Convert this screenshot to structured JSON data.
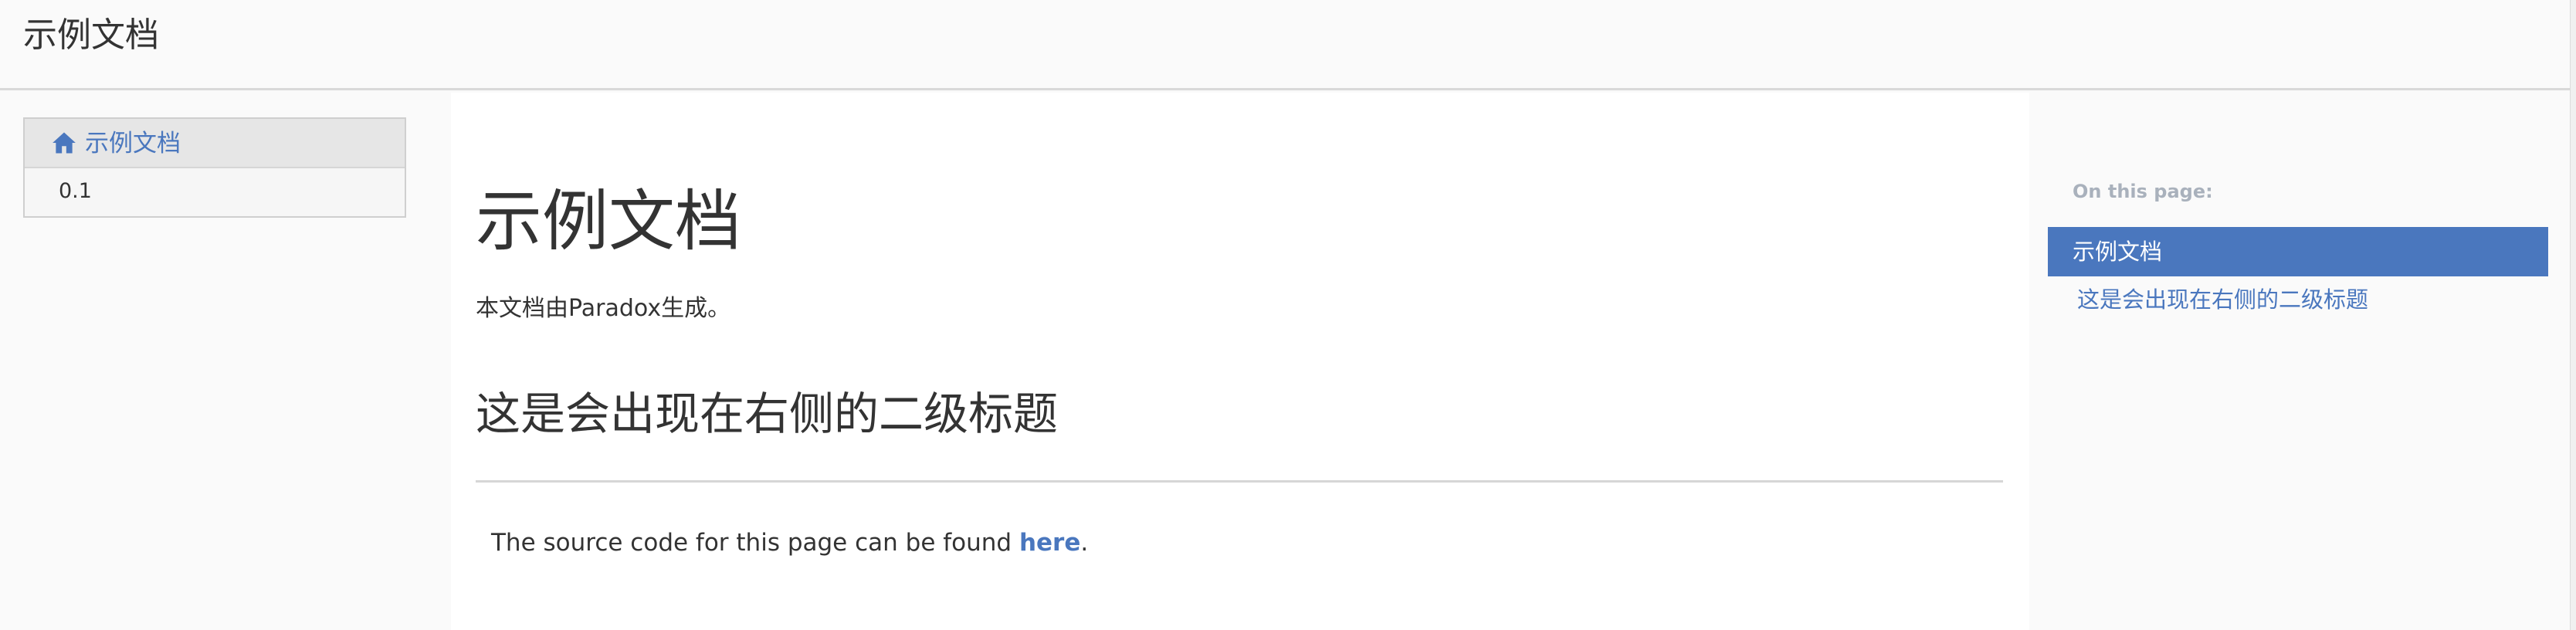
{
  "header": {
    "site_title": "示例文档"
  },
  "sidebar": {
    "items": [
      {
        "label": "示例文档",
        "icon": "home-icon"
      },
      {
        "label": "0.1"
      }
    ]
  },
  "main": {
    "title": "示例文档",
    "intro": "本文档由Paradox生成。",
    "subheading": "这是会出现在右侧的二级标题",
    "source_prefix": "The source code for this page can be found ",
    "source_link": "here",
    "source_suffix": "."
  },
  "toc": {
    "title": "On this page:",
    "items": [
      {
        "label": "示例文档"
      },
      {
        "label": "这是会出现在右侧的二级标题"
      }
    ]
  },
  "colors": {
    "accent": "#4a77be",
    "text": "#333333",
    "muted": "#a9b1bc"
  }
}
